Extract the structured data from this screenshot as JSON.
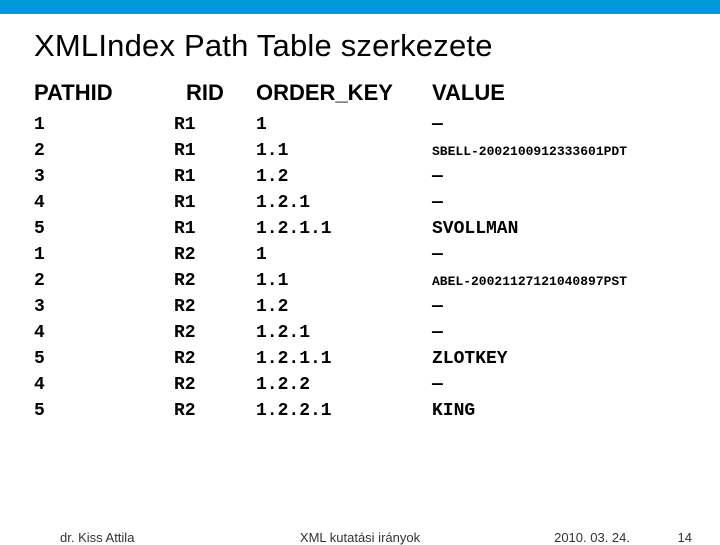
{
  "title": "XMLIndex Path Table szerkezete",
  "columns": {
    "pathid": "PATHID",
    "rid": "RID",
    "order_key": "ORDER_KEY",
    "value": "VALUE"
  },
  "rows": [
    {
      "pathid": "1",
      "rid": "R1",
      "order_key": "1",
      "value": "—",
      "small": false
    },
    {
      "pathid": "2",
      "rid": "R1",
      "order_key": "1.1",
      "value": "SBELL-2002100912333601PDT",
      "small": true
    },
    {
      "pathid": "3",
      "rid": "R1",
      "order_key": "1.2",
      "value": "—",
      "small": false
    },
    {
      "pathid": "4",
      "rid": "R1",
      "order_key": "1.2.1",
      "value": "—",
      "small": false
    },
    {
      "pathid": "5",
      "rid": "R1",
      "order_key": "1.2.1.1",
      "value": "SVOLLMAN",
      "small": false
    },
    {
      "pathid": "1",
      "rid": "R2",
      "order_key": "1",
      "value": "—",
      "small": false
    },
    {
      "pathid": "2",
      "rid": "R2",
      "order_key": "1.1",
      "value": "ABEL-20021127121040897PST",
      "small": true
    },
    {
      "pathid": "3",
      "rid": "R2",
      "order_key": "1.2",
      "value": "—",
      "small": false
    },
    {
      "pathid": "4",
      "rid": "R2",
      "order_key": "1.2.1",
      "value": "—",
      "small": false
    },
    {
      "pathid": "5",
      "rid": "R2",
      "order_key": "1.2.1.1",
      "value": "ZLOTKEY",
      "small": false
    },
    {
      "pathid": "4",
      "rid": "R2",
      "order_key": "1.2.2",
      "value": "—",
      "small": false
    },
    {
      "pathid": "5",
      "rid": "R2",
      "order_key": "1.2.2.1",
      "value": "KING",
      "small": false
    }
  ],
  "footer": {
    "author": "dr. Kiss Attila",
    "center": "XML kutatási irányok",
    "date": "2010. 03. 24.",
    "page": "14"
  }
}
